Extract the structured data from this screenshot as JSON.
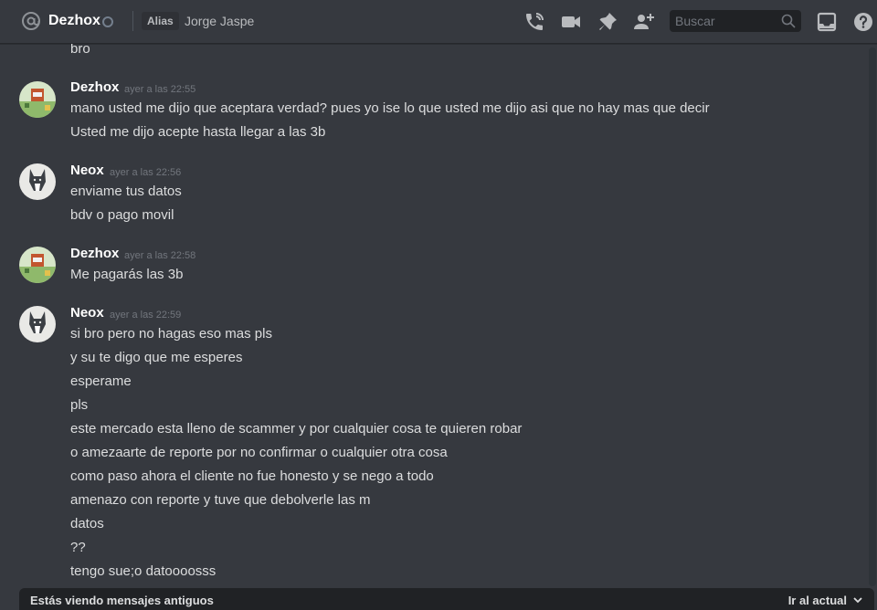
{
  "header": {
    "channel_name": "Dezhox",
    "alias_badge": "Alias",
    "real_name": "Jorge Jaspe",
    "search_placeholder": "Buscar",
    "icons": [
      "at-icon",
      "status-icon",
      "phone-call-icon",
      "video-icon",
      "pin-icon",
      "add-friend-icon",
      "search-icon",
      "inbox-icon",
      "help-icon"
    ]
  },
  "messages": {
    "prev_line": "bro",
    "groups": [
      {
        "author": "Dezhox",
        "timestamp": "ayer a las 22:55",
        "lines": [
          "mano usted me dijo que aceptara verdad? pues yo ise lo que usted me dijo asi que no hay mas que decir",
          "Usted me dijo acepte hasta llegar a las 3b"
        ]
      },
      {
        "author": "Neox",
        "timestamp": "ayer a las 22:56",
        "lines": [
          "enviame tus datos",
          "bdv o pago movil"
        ]
      },
      {
        "author": "Dezhox",
        "timestamp": "ayer a las 22:58",
        "lines": [
          "Me pagarás las 3b"
        ]
      },
      {
        "author": "Neox",
        "timestamp": "ayer a las 22:59",
        "lines": [
          "si bro pero no hagas eso mas pls",
          "y su te digo que me esperes",
          "esperame",
          "pls",
          "este mercado esta lleno de scammer y por cualquier cosa te quieren robar",
          "o amezaarte de reporte por no confirmar o cualquier otra cosa",
          "como paso ahora el cliente no fue honesto y se nego a todo",
          "amenazo con reporte y tuve que debolverle las m",
          "datos",
          "??",
          "tengo sue;o datoooosss"
        ]
      }
    ]
  },
  "footer": {
    "old_messages_notice": "Estás viendo mensajes antiguos",
    "jump_label": "Ir al actual"
  },
  "colors": {
    "background": "#36393f",
    "header_text": "#ffffff",
    "message_text": "#dcddde",
    "timestamp": "#72767d",
    "footer_bar": "#202225"
  }
}
